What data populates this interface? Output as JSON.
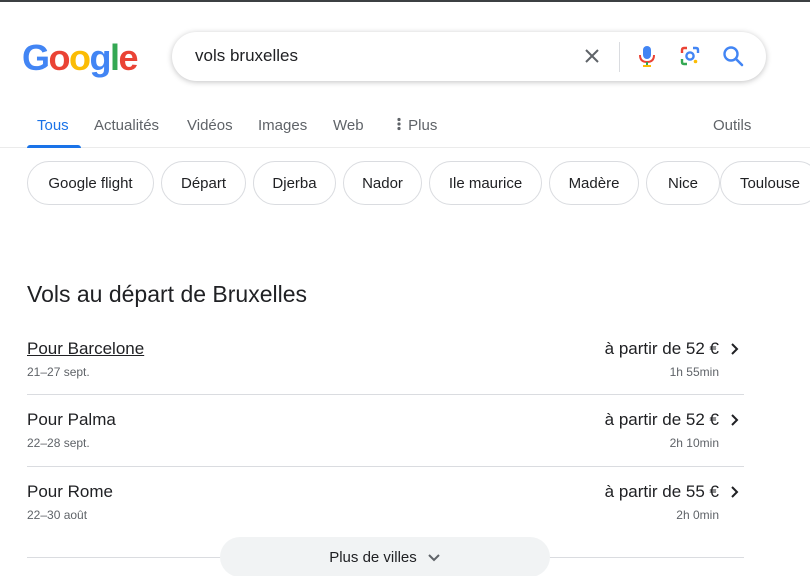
{
  "logo": {
    "letters": [
      "G",
      "o",
      "o",
      "g",
      "l",
      "e"
    ],
    "colors": [
      "#4285F4",
      "#EA4335",
      "#FBBC05",
      "#4285F4",
      "#34A853",
      "#EA4335"
    ]
  },
  "search": {
    "query": "vols bruxelles",
    "icons": [
      "clear-icon",
      "mic-icon",
      "lens-icon",
      "search-icon"
    ]
  },
  "tabs": {
    "items": [
      {
        "label": "Tous",
        "active": true
      },
      {
        "label": "Actualités",
        "active": false
      },
      {
        "label": "Vidéos",
        "active": false
      },
      {
        "label": "Images",
        "active": false
      },
      {
        "label": "Web",
        "active": false
      },
      {
        "label": "Plus",
        "active": false
      }
    ],
    "tools": "Outils",
    "accent": "#1a73e8"
  },
  "chips": [
    "Google flight",
    "Départ",
    "Djerba",
    "Nador",
    "Ile maurice",
    "Madère",
    "Nice",
    "Toulouse"
  ],
  "flights": {
    "title": "Vols au départ de Bruxelles",
    "items": [
      {
        "dest": "Pour Barcelone",
        "dates": "21–27 sept.",
        "price": "à partir de 52 €",
        "duration": "1h 55min"
      },
      {
        "dest": "Pour Palma",
        "dates": "22–28 sept.",
        "price": "à partir de 52 €",
        "duration": "2h 10min"
      },
      {
        "dest": "Pour Rome",
        "dates": "22–30 août",
        "price": "à partir de 55 €",
        "duration": "2h 0min"
      }
    ],
    "more_label": "Plus de villes"
  }
}
